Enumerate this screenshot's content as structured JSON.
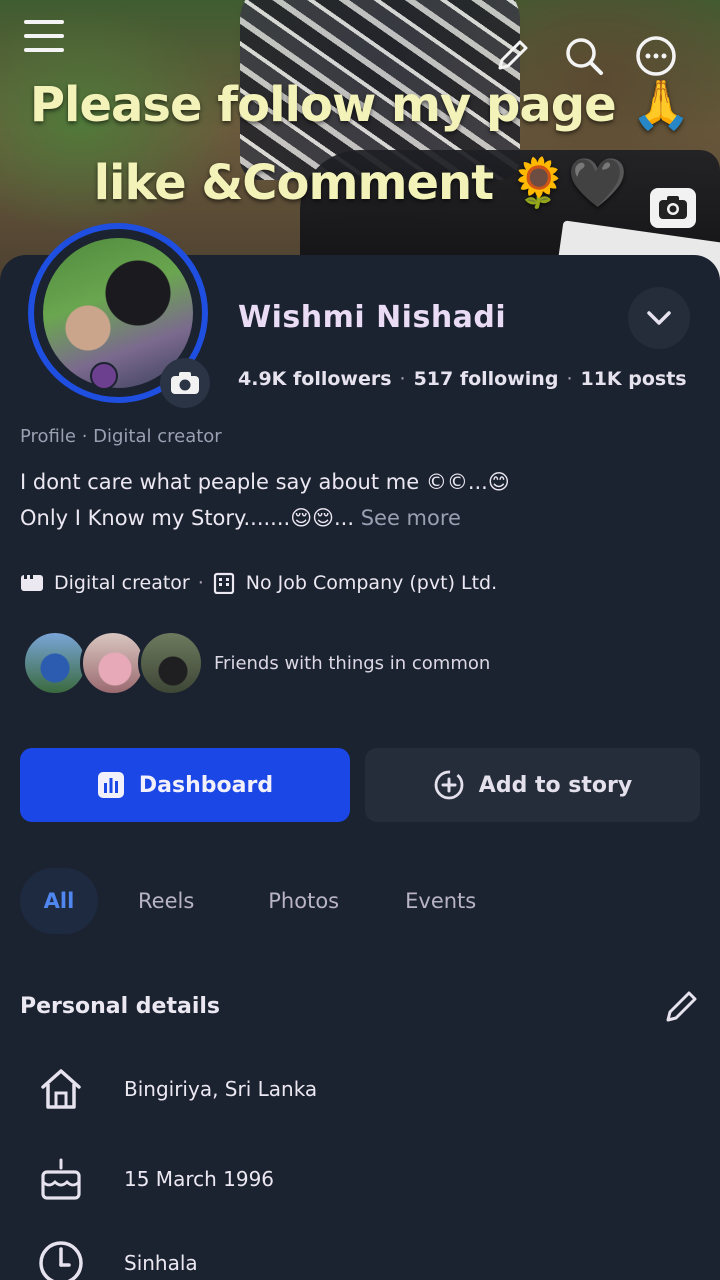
{
  "overlay": {
    "line1": "Please follow my page 🙏",
    "line2": "like &Comment 🌻🖤"
  },
  "top_icons": [
    "menu-icon",
    "edit-pencil-icon",
    "search-icon",
    "more-icon"
  ],
  "profile": {
    "name": "Wishmi Nishadi",
    "followers": "4.9K followers",
    "following": "517 following",
    "posts": "11K posts",
    "category": "Profile · Digital creator",
    "bio_line1": "I dont care what peaple  say about me ©©...😊",
    "bio_line2": "Only I Know my Story.......😌😌...",
    "see_more": "See more",
    "info_creator": "Digital creator",
    "info_company": "No Job Company (pvt) Ltd.",
    "friends_text": "Friends with things in common"
  },
  "buttons": {
    "dashboard": "Dashboard",
    "add_story": "Add to story"
  },
  "tabs": [
    "All",
    "Reels",
    "Photos",
    "Events"
  ],
  "personal": {
    "title": "Personal details",
    "items": [
      {
        "icon": "home-icon",
        "text": "Bingiriya, Sri Lanka"
      },
      {
        "icon": "birthday-cake-icon",
        "text": "15 March 1996"
      },
      {
        "icon": "language-icon",
        "text": "Sinhala"
      }
    ]
  },
  "colors": {
    "accent": "#1a47e6",
    "background": "#1b2230",
    "overlay_text": "#f3f2b8"
  }
}
